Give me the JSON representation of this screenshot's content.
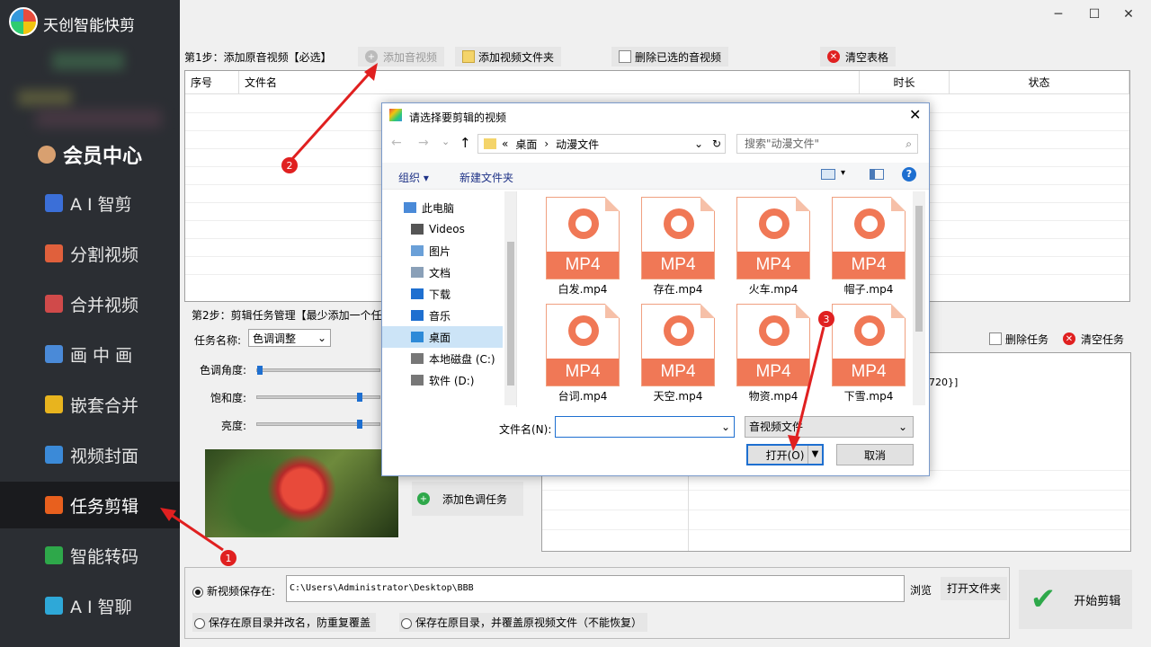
{
  "app": {
    "title": "天创智能快剪"
  },
  "window": {
    "minimize": "─",
    "maximize": "☐",
    "close": "✕"
  },
  "sidebar": {
    "vip": "会员中心",
    "items": [
      {
        "label": "A I 智剪",
        "icon": "ai-cut-icon",
        "color": "#3b6fd8"
      },
      {
        "label": "分割视频",
        "icon": "split-video-icon",
        "color": "#e0603c"
      },
      {
        "label": "合并视频",
        "icon": "merge-video-icon",
        "color": "#d04a4a"
      },
      {
        "label": "画 中 画",
        "icon": "pip-icon",
        "color": "#4a8ad8"
      },
      {
        "label": "嵌套合并",
        "icon": "nest-merge-icon",
        "color": "#e8b41e"
      },
      {
        "label": "视频封面",
        "icon": "video-cover-icon",
        "color": "#3b8ad8"
      },
      {
        "label": "任务剪辑",
        "icon": "task-edit-icon",
        "color": "#e8601e",
        "active": true
      },
      {
        "label": "智能转码",
        "icon": "transcode-icon",
        "color": "#2ea84a"
      },
      {
        "label": "A I 智聊",
        "icon": "ai-chat-icon",
        "color": "#2ea8d8"
      }
    ]
  },
  "step1": {
    "label": "第1步：添加原音视频【必选】",
    "add_video": "添加音视频",
    "add_folder": "添加视频文件夹",
    "delete_selected": "删除已选的音视频",
    "clear_table": "清空表格",
    "columns": [
      "序号",
      "文件名",
      "时长",
      "状态"
    ]
  },
  "step2": {
    "label": "第2步：剪辑任务管理【最少添加一个任",
    "task_name_label": "任务名称:",
    "task_name_value": "色调调整",
    "hue_label": "色调角度:",
    "saturation_label": "饱和度:",
    "brightness_label": "亮度:",
    "hue": 0.0,
    "saturation": 0.85,
    "brightness": 0.85,
    "add_task": "添加色调任务",
    "delete_task": "删除任务",
    "clear_task": "清空任务",
    "task_text": "720}]"
  },
  "save": {
    "new_save_label": "新视频保存在:",
    "path": "C:\\Users\\Administrator\\Desktop\\BBB",
    "browse": "浏览",
    "open_folder": "打开文件夹",
    "option2": "保存在原目录并改名，防重复覆盖",
    "option3": "保存在原目录，并覆盖原视频文件（不能恢复）",
    "start": "开始剪辑"
  },
  "dialog": {
    "title": "请选择要剪辑的视频",
    "crumbs": [
      "«",
      "桌面",
      "›",
      "动漫文件"
    ],
    "search_placeholder": "搜索\"动漫文件\"",
    "organize": "组织 ▾",
    "new_folder": "新建文件夹",
    "tree": [
      {
        "label": "此电脑",
        "icon": "computer-icon"
      },
      {
        "label": "Videos",
        "icon": "videos-folder-icon"
      },
      {
        "label": "图片",
        "icon": "pictures-folder-icon"
      },
      {
        "label": "文档",
        "icon": "documents-folder-icon"
      },
      {
        "label": "下载",
        "icon": "downloads-folder-icon"
      },
      {
        "label": "音乐",
        "icon": "music-folder-icon"
      },
      {
        "label": "桌面",
        "icon": "desktop-folder-icon",
        "selected": true
      },
      {
        "label": "本地磁盘 (C:)",
        "icon": "drive-c-icon"
      },
      {
        "label": "软件 (D:)",
        "icon": "drive-d-icon"
      }
    ],
    "files": [
      "白发.mp4",
      "存在.mp4",
      "火车.mp4",
      "帽子.mp4",
      "台词.mp4",
      "天空.mp4",
      "物资.mp4",
      "下雪.mp4"
    ],
    "filetype_badge": "MP4",
    "filename_label": "文件名(N):",
    "filetype": "音视频文件",
    "open": "打开(O)",
    "cancel": "取消"
  },
  "annotations": [
    "1",
    "2",
    "3"
  ]
}
